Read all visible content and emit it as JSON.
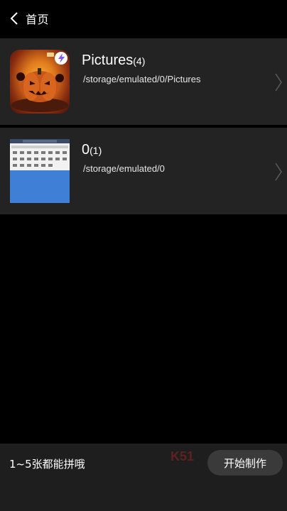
{
  "header": {
    "back_label": "首页",
    "back_icon": "chevron-left-icon"
  },
  "albums": [
    {
      "title": "Pictures",
      "count": "(4)",
      "path": "/storage/emulated/0/Pictures",
      "thumbnail": "pumpkin-game-art-thumbnail"
    },
    {
      "title": "0",
      "count": "(1)",
      "path": "/storage/emulated/0",
      "thumbnail": "screenshot-thumbnail"
    }
  ],
  "footer": {
    "hint": "1~5张都能拼哦",
    "watermark": "K51",
    "start_label": "开始制作"
  },
  "colors": {
    "background": "#000000",
    "row_background": "#232323",
    "bottom_bar": "#1e1e1e",
    "button": "#3a3a3a",
    "text": "#ffffff"
  }
}
